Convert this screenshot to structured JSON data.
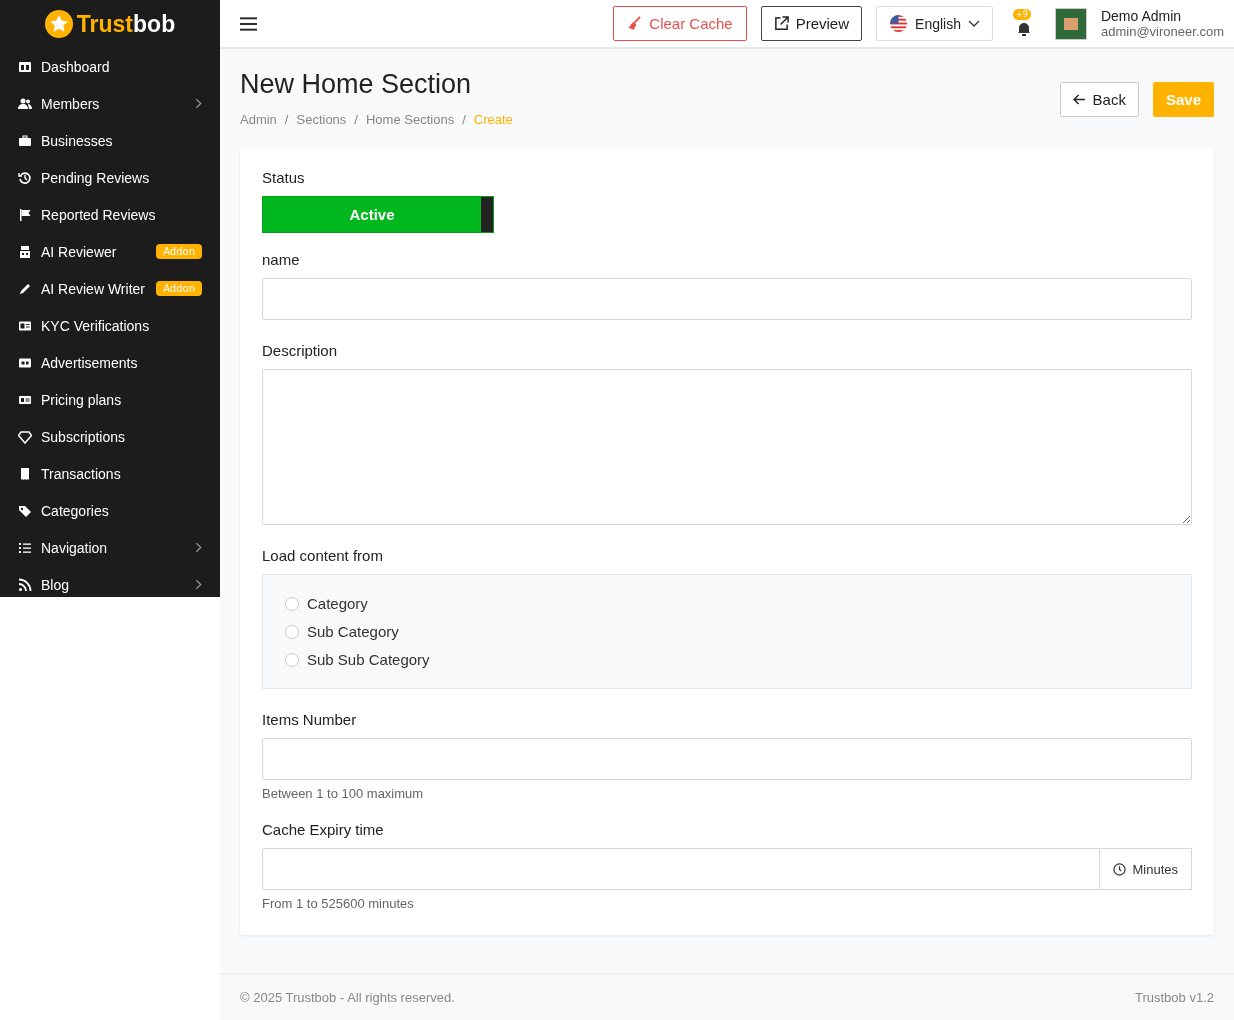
{
  "brand": {
    "part1": "Trust",
    "part2": "bob"
  },
  "sidebar": {
    "items": [
      {
        "label": "Dashboard",
        "has_submenu": false
      },
      {
        "label": "Members",
        "has_submenu": true
      },
      {
        "label": "Businesses",
        "has_submenu": false
      },
      {
        "label": "Pending Reviews",
        "has_submenu": false
      },
      {
        "label": "Reported Reviews",
        "has_submenu": false
      },
      {
        "label": "AI Reviewer",
        "has_submenu": false,
        "badge": "Addon"
      },
      {
        "label": "AI Review Writer",
        "has_submenu": false,
        "badge": "Addon"
      },
      {
        "label": "KYC Verifications",
        "has_submenu": false
      },
      {
        "label": "Advertisements",
        "has_submenu": false
      },
      {
        "label": "Pricing plans",
        "has_submenu": false
      },
      {
        "label": "Subscriptions",
        "has_submenu": false
      },
      {
        "label": "Transactions",
        "has_submenu": false
      },
      {
        "label": "Categories",
        "has_submenu": false
      },
      {
        "label": "Navigation",
        "has_submenu": true
      },
      {
        "label": "Blog",
        "has_submenu": true
      }
    ]
  },
  "topbar": {
    "clear_cache": "Clear Cache",
    "preview": "Preview",
    "language": "English",
    "notification_count": "+9",
    "user_name": "Demo Admin",
    "user_email": "admin@vironeer.com"
  },
  "page": {
    "title": "New Home Section",
    "separator": "/",
    "breadcrumb": [
      {
        "label": "Admin",
        "current": false
      },
      {
        "label": "Sections",
        "current": false
      },
      {
        "label": "Home Sections",
        "current": false
      },
      {
        "label": "Create",
        "current": true
      }
    ],
    "back": "Back",
    "save": "Save"
  },
  "form": {
    "status_label": "Status",
    "status": {
      "label": "Active",
      "on": true
    },
    "name_label": "name",
    "description_label": "Description",
    "load_label": "Load content from",
    "load_options": [
      {
        "label": "Category",
        "selected": false
      },
      {
        "label": "Sub Category",
        "selected": false
      },
      {
        "label": "Sub Sub Category",
        "selected": false
      }
    ],
    "items_label": "Items Number",
    "items_hint": "Between 1 to 100 maximum",
    "cache_label": "Cache Expiry time",
    "cache_unit": "Minutes",
    "cache_hint": "From 1 to 525600 minutes"
  },
  "footer": {
    "copyright": "© 2025 Trustbob - All rights reserved.",
    "version": "Trustbob v1.2"
  }
}
